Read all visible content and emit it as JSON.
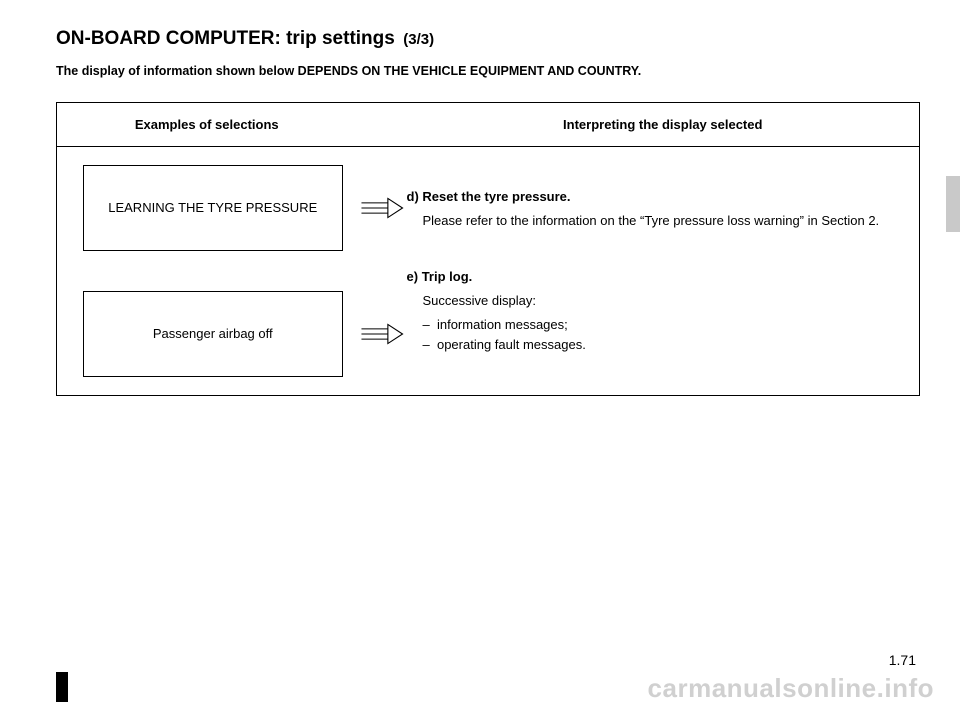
{
  "title": {
    "main": "ON-BOARD COMPUTER: trip settings",
    "sub": "(3/3)"
  },
  "notice": "The display of information shown below DEPENDS ON THE VEHICLE EQUIPMENT AND COUNTRY.",
  "table": {
    "header_left": "Examples of selections",
    "header_right": "Interpreting the display selected"
  },
  "rows": [
    {
      "lcd": "LEARNING THE  TYRE PRESSURE",
      "letter": "d)",
      "head": "Reset the tyre pressure.",
      "body": "Please refer to the information on the “Tyre pressure loss warning” in Section 2."
    },
    {
      "lcd": "Passenger airbag off",
      "letter": "e)",
      "head": "Trip log.",
      "body": "Successive display:",
      "bullets": [
        "information messages;",
        "operating fault messages."
      ]
    }
  ],
  "pagenum": "1.71",
  "watermark": "carmanualsonline.info"
}
